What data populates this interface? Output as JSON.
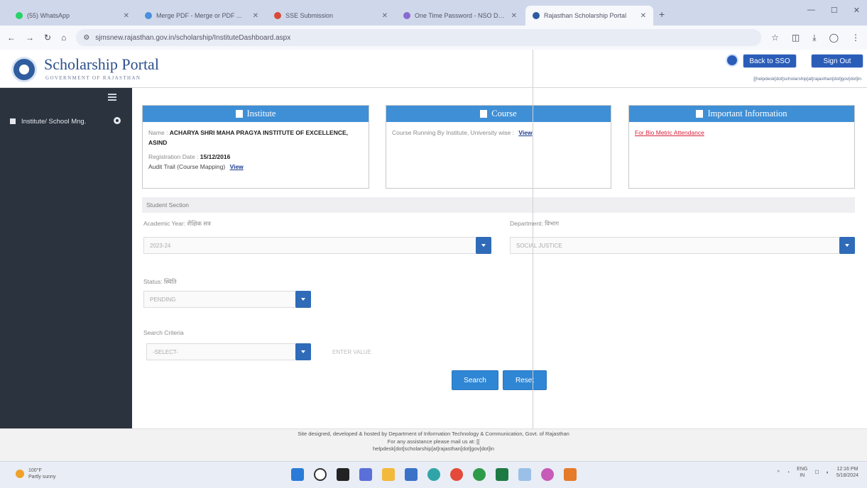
{
  "browser": {
    "tabs": [
      {
        "label": "(55) WhatsApp",
        "color": "#25d366",
        "active": false
      },
      {
        "label": "Merge PDF - Merge or PDF ...",
        "color": "#4a8fdc",
        "active": false
      },
      {
        "label": "SSE Submission",
        "color": "#d84a3a",
        "active": false
      },
      {
        "label": "One Time Password - NSO DU...",
        "color": "#8a6ad0",
        "active": false
      },
      {
        "label": "Rajasthan Scholarship Portal",
        "color": "#2c5aa0",
        "active": true
      }
    ],
    "url": "sjmsnew.rajasthan.gov.in/scholarship/InstituteDashboard.aspx"
  },
  "header": {
    "title": "Scholarship Portal",
    "subtitle": "GOVERNMENT OF RAJASTHAN",
    "back_to_sso": "Back to SSO",
    "sign_out": "Sign Out",
    "helpdesk": "[[helpdesk[dot]scholarship[at]rajasthan[dot]gov[dot]in"
  },
  "sidebar": {
    "items": [
      {
        "label": "Institute/ School Mng."
      }
    ]
  },
  "cards": {
    "institute": {
      "title": "Institute",
      "name_label": "Name :",
      "name_value": "ACHARYA SHRI MAHA PRAGYA INSTITUTE OF EXCELLENCE, ASIND",
      "reg_label": "Registration Date :",
      "reg_value": "15/12/2016",
      "audit_label": "Audit Trail (Course Mapping)",
      "view": "View"
    },
    "course": {
      "title": "Course",
      "text": "Course Running By Institute, University wise :",
      "view": "View"
    },
    "info": {
      "title": "Important Information",
      "link": "For Bio Metric Attendance"
    }
  },
  "student_section": {
    "heading": "Student Section",
    "academic_year_label": "Academic Year: शैक्षिक सत्र",
    "academic_year_value": "2023-24",
    "department_label": "Department: विभाग",
    "department_value": "SOCIAL JUSTICE",
    "status_label": "Status: स्थिति",
    "status_value": "PENDING",
    "search_criteria_label": "Search Criteria",
    "search_criteria_value": "-SELECT-",
    "search_value_placeholder": "ENTER VALUE",
    "search_button": "Search",
    "reset_button": "Reset"
  },
  "footer": {
    "line1": "Site designed, developed & hosted by Department of Information Technology & Communication, Govt. of Rajasthan",
    "line2": "For any assistance please mail us at: [[",
    "line3": "helpdesk[dot]scholarship[at]rajasthan[dot]gov[dot]in"
  },
  "taskbar": {
    "weather_temp": "100°F",
    "weather_desc": "Partly sunny",
    "lang": "ENG",
    "region": "IN",
    "time": "12:16 PM",
    "date": "5/18/2024"
  }
}
